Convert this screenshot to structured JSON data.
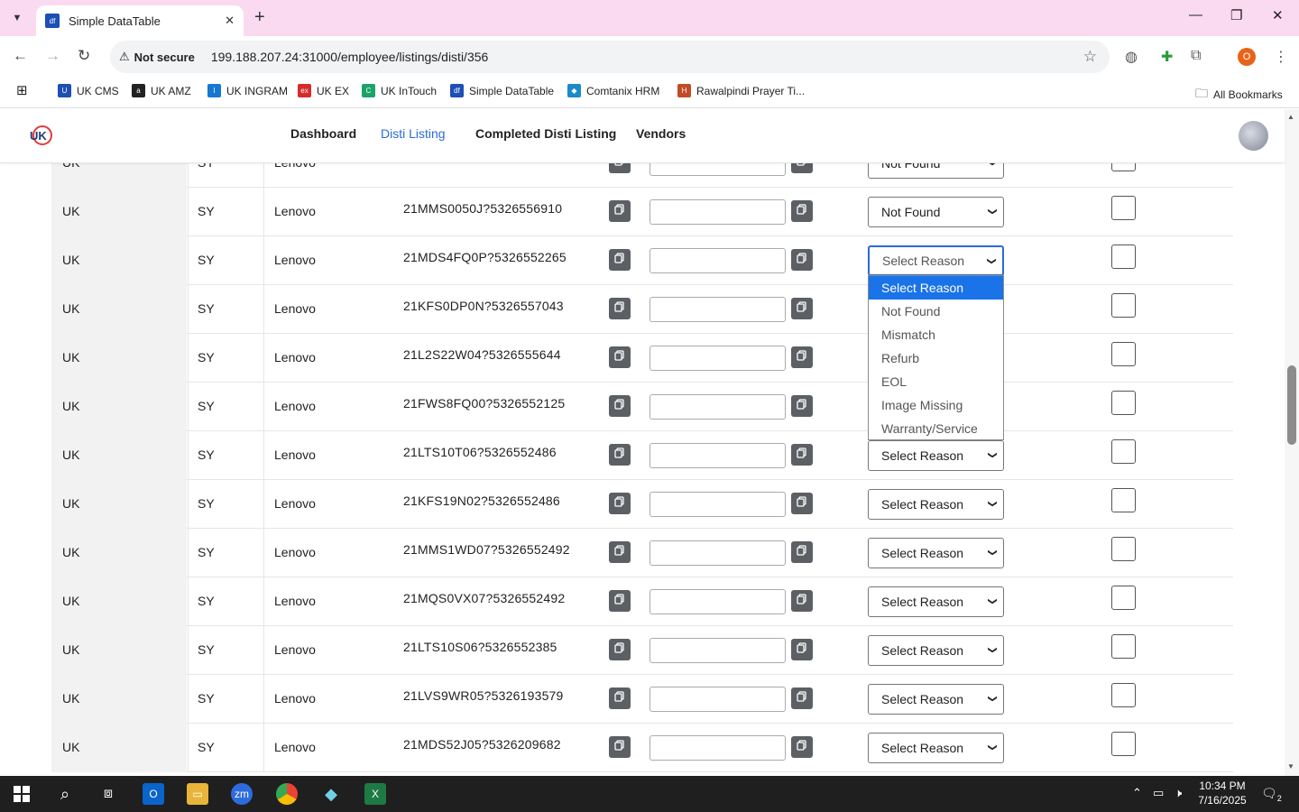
{
  "browser": {
    "tab_title": "Simple DataTable",
    "tab_favicon": "df",
    "url_security": "Not secure",
    "url": "199.188.207.24:31000/employee/listings/disti/356",
    "profile_initial": "O",
    "bookmarks": [
      {
        "label": "UK CMS",
        "color": "#1d4fb5",
        "glyph": "U"
      },
      {
        "label": "UK AMZ",
        "color": "#222222",
        "glyph": "a"
      },
      {
        "label": "UK INGRAM",
        "color": "#1877d2",
        "glyph": "I"
      },
      {
        "label": "UK EX",
        "color": "#d62b2b",
        "glyph": "ex"
      },
      {
        "label": "UK InTouch",
        "color": "#1aa36a",
        "glyph": "C"
      },
      {
        "label": "Simple DataTable",
        "color": "#1d4fb5",
        "glyph": "df"
      },
      {
        "label": "Comtanix HRM",
        "color": "#1a8ac9",
        "glyph": "◆"
      },
      {
        "label": "Rawalpindi Prayer Ti...",
        "color": "#c24b26",
        "glyph": "H"
      }
    ],
    "all_bookmarks": "All Bookmarks"
  },
  "app": {
    "nav": [
      "Dashboard",
      "Disti Listing",
      "Completed Disti Listing",
      "Vendors"
    ],
    "active_nav": "Disti Listing"
  },
  "table": {
    "partial_top": {
      "country": "UK",
      "code": "SY",
      "brand": "Lenovo",
      "reason": "Not Found"
    },
    "rows": [
      {
        "country": "UK",
        "code": "SY",
        "brand": "Lenovo",
        "sku": "21MMS0050J?5326556910",
        "reason": "Not Found"
      },
      {
        "country": "UK",
        "code": "SY",
        "brand": "Lenovo",
        "sku": "21MDS4FQ0P?5326552265",
        "reason": "Select Reason"
      },
      {
        "country": "UK",
        "code": "SY",
        "brand": "Lenovo",
        "sku": "21KFS0DP0N?5326557043",
        "reason": ""
      },
      {
        "country": "UK",
        "code": "SY",
        "brand": "Lenovo",
        "sku": "21L2S22W04?5326555644",
        "reason": ""
      },
      {
        "country": "UK",
        "code": "SY",
        "brand": "Lenovo",
        "sku": "21FWS8FQ00?5326552125",
        "reason": ""
      },
      {
        "country": "UK",
        "code": "SY",
        "brand": "Lenovo",
        "sku": "21LTS10T06?5326552486",
        "reason": "Select Reason"
      },
      {
        "country": "UK",
        "code": "SY",
        "brand": "Lenovo",
        "sku": "21KFS19N02?5326552486",
        "reason": "Select Reason"
      },
      {
        "country": "UK",
        "code": "SY",
        "brand": "Lenovo",
        "sku": "21MMS1WD07?5326552492",
        "reason": "Select Reason"
      },
      {
        "country": "UK",
        "code": "SY",
        "brand": "Lenovo",
        "sku": "21MQS0VX07?5326552492",
        "reason": "Select Reason"
      },
      {
        "country": "UK",
        "code": "SY",
        "brand": "Lenovo",
        "sku": "21LTS10S06?5326552385",
        "reason": "Select Reason"
      },
      {
        "country": "UK",
        "code": "SY",
        "brand": "Lenovo",
        "sku": "21LVS9WR05?5326193579",
        "reason": "Select Reason"
      },
      {
        "country": "UK",
        "code": "SY",
        "brand": "Lenovo",
        "sku": "21MDS52J05?5326209682",
        "reason": "Select Reason"
      }
    ]
  },
  "dropdown": {
    "options": [
      "Select Reason",
      "Not Found",
      "Mismatch",
      "Refurb",
      "EOL",
      "Image Missing",
      "Warranty/Service"
    ],
    "selected": "Select Reason"
  },
  "taskbar": {
    "time": "10:34 PM",
    "date": "7/16/2025",
    "notifications": "2"
  }
}
